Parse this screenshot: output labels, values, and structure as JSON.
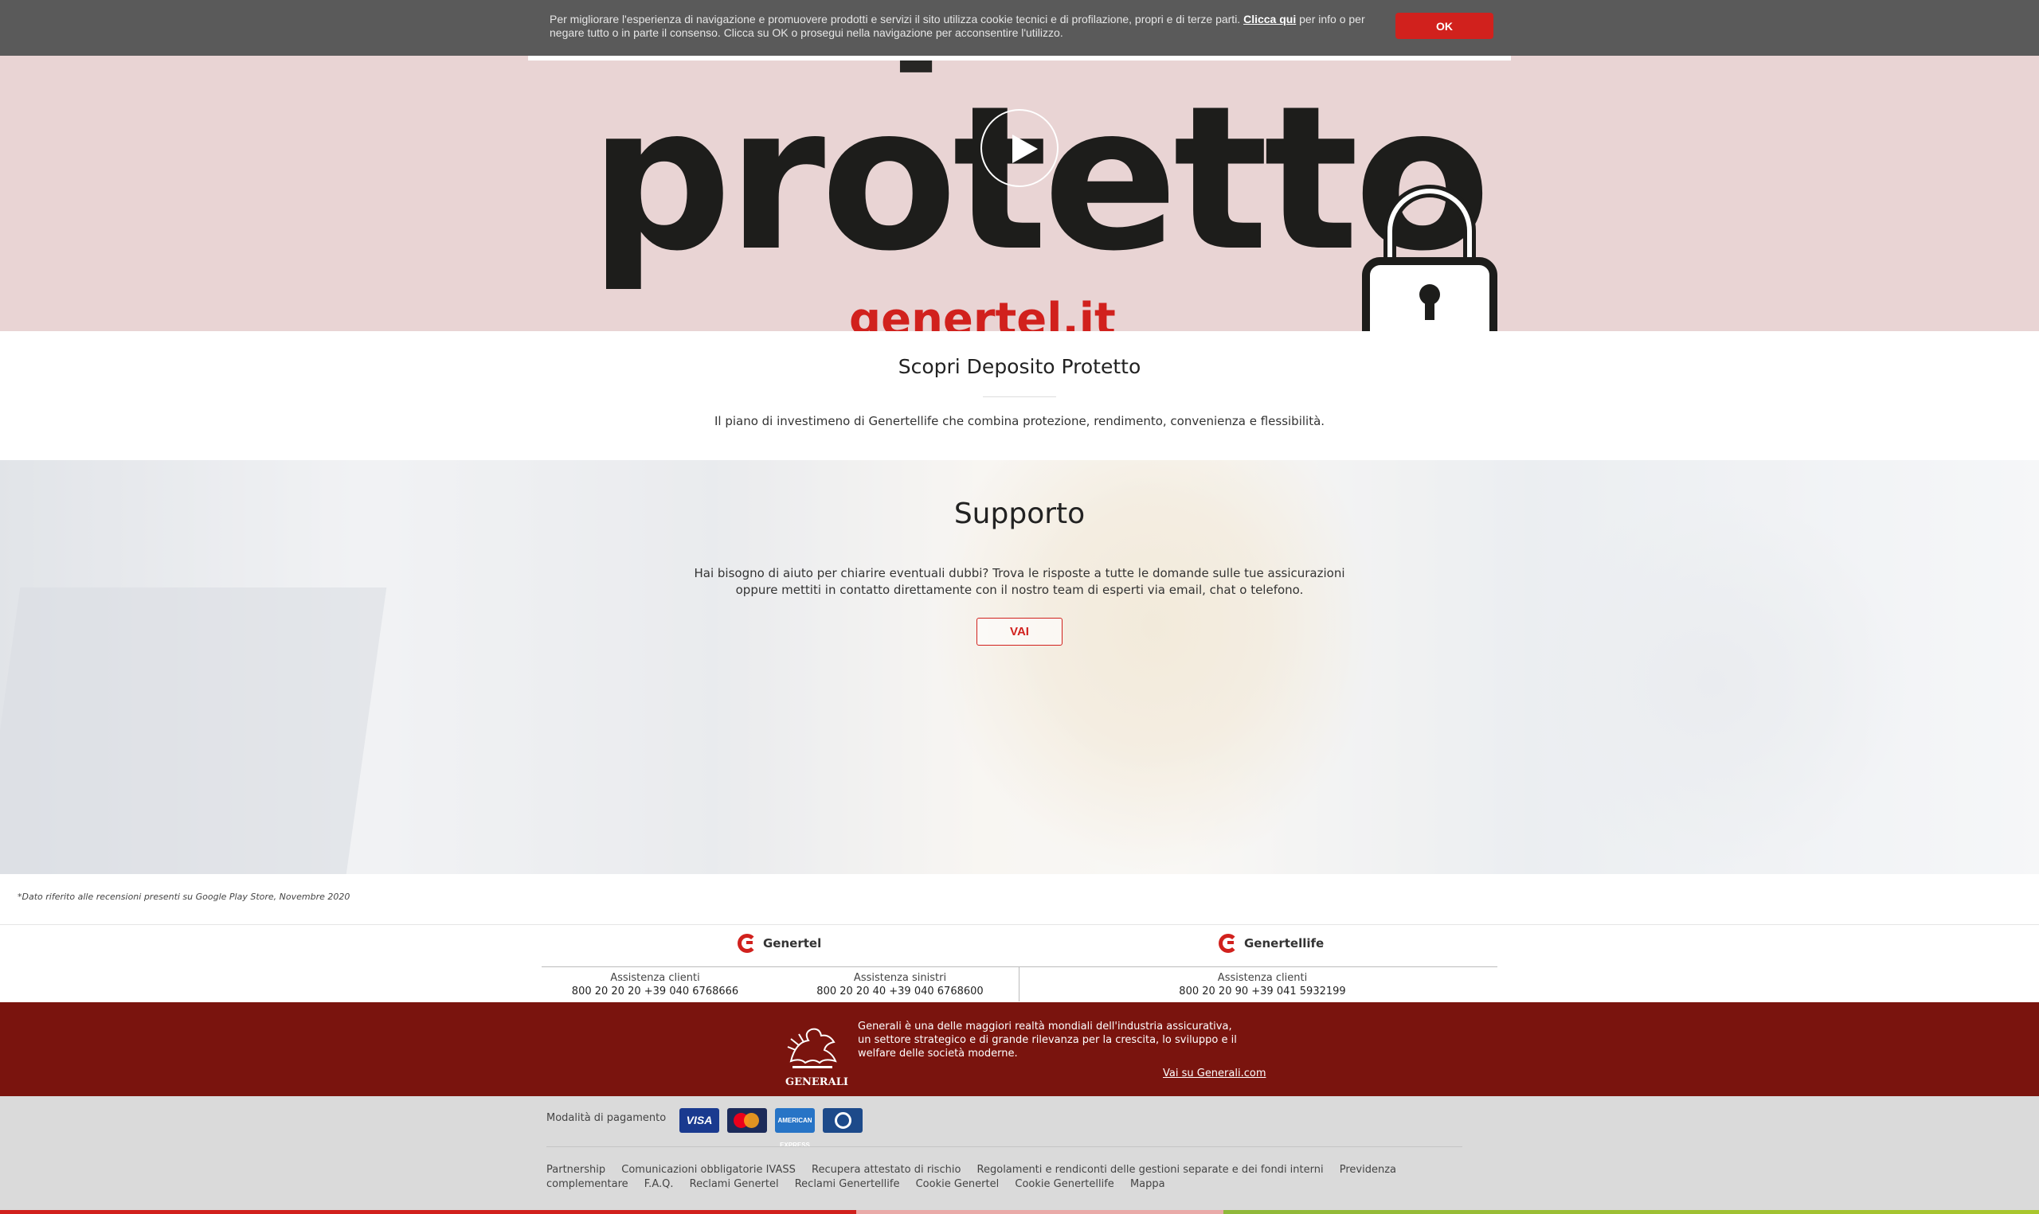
{
  "cookie": {
    "text": "Per migliorare l'esperienza di navigazione e promuovere prodotti e servizi il sito utilizza cookie tecnici e di profilazione, propri e di terze parti.",
    "link": "Clicca qui",
    "text2": "per info o per negare tutto o in parte il consenso. Clicca su OK o prosegui nella navigazione per acconsentire l'utilizzo.",
    "ok_label": "OK"
  },
  "hero": {
    "word": "protetto",
    "partial_word": "deposito",
    "logo_text": "genertel.it"
  },
  "scopri": {
    "title": "Scopri Deposito Protetto",
    "desc": "Il piano di investimeno di Genertellife che combina protezione, rendimento, convenienza e flessibilità."
  },
  "supporto": {
    "title": "Supporto",
    "desc": "Hai bisogno di aiuto per chiarire eventuali dubbi? Trova le risposte a tutte le domande sulle tue assicurazioni oppure mettiti in contatto direttamente con il nostro team di esperti via email, chat o telefono.",
    "button": "VAI"
  },
  "note": "*Dato riferito alle recensioni presenti su Google Play Store, Novembre 2020",
  "contacts": {
    "genertel": {
      "brand": "Genertel",
      "clienti_label": "Assistenza clienti",
      "clienti_num": "800 20 20 20  +39 040 6768666",
      "sinistri_label": "Assistenza sinistri",
      "sinistri_num": "800 20 20 40  +39 040 6768600"
    },
    "genertellife": {
      "brand": "Genertellife",
      "clienti_label": "Assistenza clienti",
      "clienti_num": "800 20 20 90  +39 041 5932199"
    }
  },
  "generali": {
    "logo_text": "GENERALI",
    "text": "Generali è una delle maggiori realtà mondiali dell'industria assicurativa, un settore strategico e di grande rilevanza per la crescita, lo sviluppo e il welfare delle società moderne.",
    "link": "Vai su Generali.com"
  },
  "footer": {
    "pay_label": "Modalità di pagamento",
    "cards": [
      "VISA",
      "MasterCard",
      "AMERICAN EXPRESS",
      "Diners"
    ],
    "links": [
      "Partnership",
      "Comunicazioni obbligatorie IVASS",
      "Recupera attestato di rischio",
      "Regolamenti e rendiconti delle gestioni separate e dei fondi interni",
      "Previdenza complementare",
      "F.A.Q.",
      "Reclami Genertel",
      "Reclami Genertellife",
      "Cookie Genertel",
      "Cookie Genertellife",
      "Mappa"
    ]
  },
  "colors": {
    "accent": "#d1211d",
    "generali_red": "#7a140e",
    "hero_bg": "#e9d4d4"
  }
}
